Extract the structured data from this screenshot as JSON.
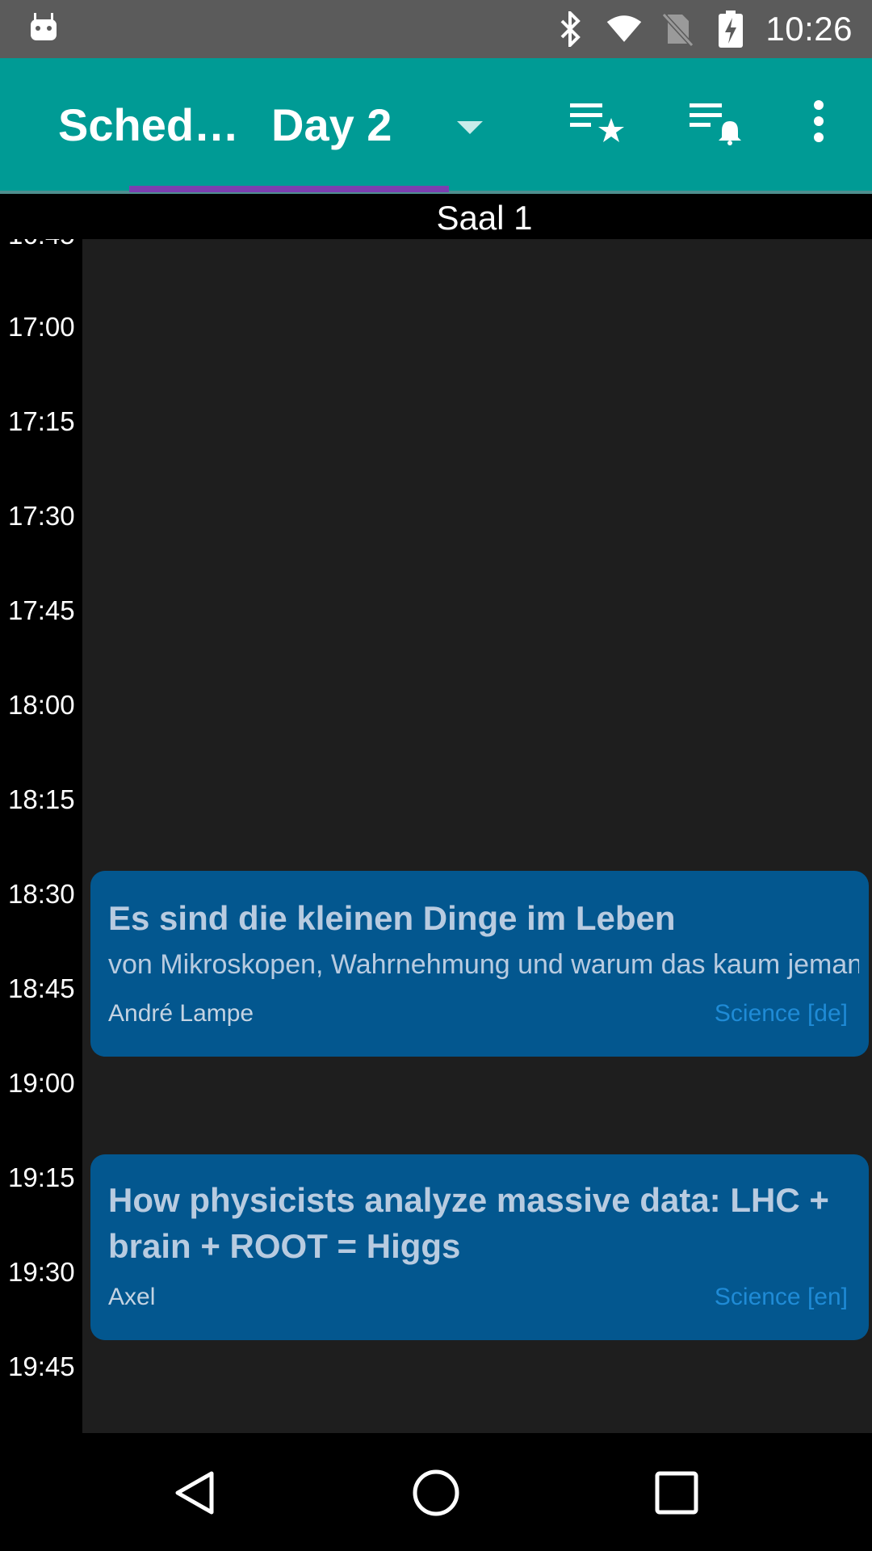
{
  "status_bar": {
    "time": "10:26",
    "icons": [
      "android-icon",
      "bluetooth-icon",
      "wifi-icon",
      "no-sim-icon",
      "battery-charging-icon"
    ]
  },
  "toolbar": {
    "title": "Sched…",
    "selected_day": "Day 2",
    "actions": [
      "starred-list-icon",
      "alarms-list-icon",
      "overflow-menu-icon"
    ]
  },
  "room": "Saal 1",
  "time_slots": [
    "17:00",
    "17:15",
    "17:30",
    "17:45",
    "18:00",
    "18:15",
    "18:30",
    "18:45",
    "19:00",
    "19:15",
    "19:30",
    "19:45"
  ],
  "events": [
    {
      "title": "Es sind die kleinen Dinge im Leben",
      "subtitle": "von Mikroskopen, Wahrnehmung und warum das kaum jemanden interessiert",
      "speaker": "André Lampe",
      "track": "Science [de]"
    },
    {
      "title_line1": "How physicists analyze massive data: LHC +",
      "title_line2": "brain + ROOT = Higgs",
      "speaker": "Axel",
      "track": "Science [en]"
    }
  ],
  "colors": {
    "status_bar": "#5b5b5b",
    "toolbar": "#009b95",
    "tab_indicator": "#7b3fb0",
    "event_background": "#03578f",
    "track_text": "#1f8bd6",
    "grid_background": "#1e1e1e"
  }
}
